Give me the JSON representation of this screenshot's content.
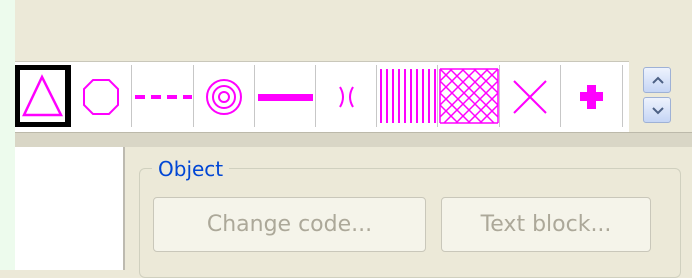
{
  "colors": {
    "magenta": "#ff00ff",
    "disabled_text": "#aca899",
    "group_title": "#0046d5"
  },
  "palette": {
    "items": [
      {
        "name": "triangle",
        "selected": true
      },
      {
        "name": "octagon",
        "selected": false
      },
      {
        "name": "dashed-line",
        "selected": false
      },
      {
        "name": "concentric-circles",
        "selected": false
      },
      {
        "name": "thick-line",
        "selected": false
      },
      {
        "name": "bracket-pair",
        "selected": false
      },
      {
        "name": "vertical-hatch",
        "selected": false
      },
      {
        "name": "cross-hatch",
        "selected": false
      },
      {
        "name": "x-cross",
        "selected": false
      },
      {
        "name": "plus-cross",
        "selected": false
      }
    ],
    "scroll_up_icon": "scroll-up-icon",
    "scroll_down_icon": "scroll-down-icon"
  },
  "object_group": {
    "title": "Object",
    "change_code_label": "Change code...",
    "text_block_label": "Text block..."
  }
}
